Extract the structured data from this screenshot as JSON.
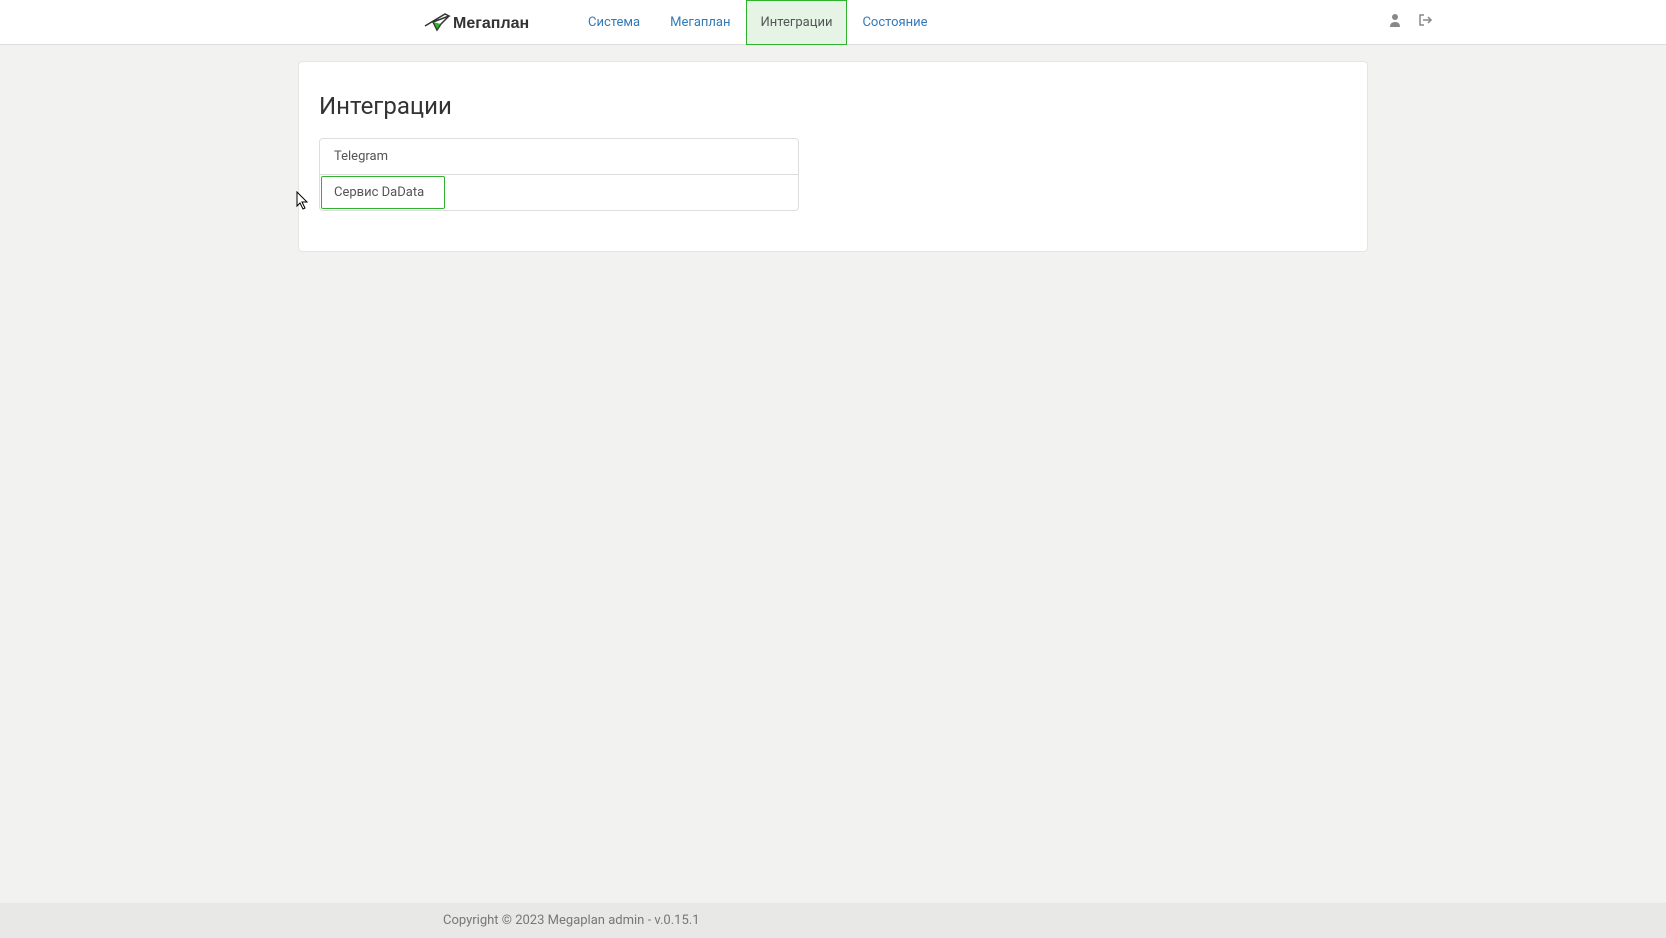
{
  "header": {
    "logo_text": "Мегаплан",
    "nav": [
      {
        "label": "Система",
        "active": false
      },
      {
        "label": "Мегаплан",
        "active": false
      },
      {
        "label": "Интеграции",
        "active": true
      },
      {
        "label": "Состояние",
        "active": false
      }
    ]
  },
  "page": {
    "title": "Интеграции",
    "integrations": [
      {
        "name": "Telegram",
        "selected": false
      },
      {
        "name": "Сервис DaData",
        "selected": true
      }
    ]
  },
  "footer": {
    "text": "Copyright © 2023 Megaplan admin - v.0.15.1"
  }
}
